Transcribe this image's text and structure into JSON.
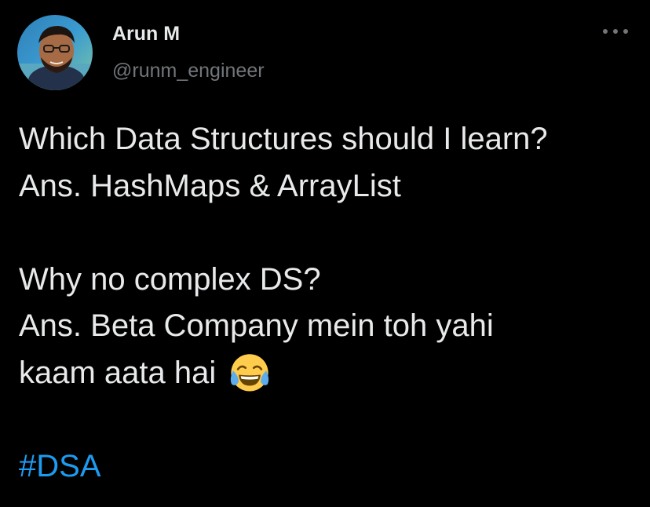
{
  "author": {
    "display_name": "Arun M",
    "handle": "@runm_engineer"
  },
  "menu": {
    "icon": "more-horizontal-icon"
  },
  "tweet": {
    "lines": [
      "Which Data Structures should I learn?",
      "Ans. HashMaps & ArrayList",
      "",
      "Why no complex DS?",
      "Ans. Beta Company mein toh yahi",
      "kaam aata hai"
    ],
    "emoji": "face-with-tears-of-joy-icon",
    "hashtag": "#DSA"
  },
  "colors": {
    "background": "#000000",
    "text": "#e7e9ea",
    "secondary_text": "#71767b",
    "link": "#1d9bf0"
  }
}
